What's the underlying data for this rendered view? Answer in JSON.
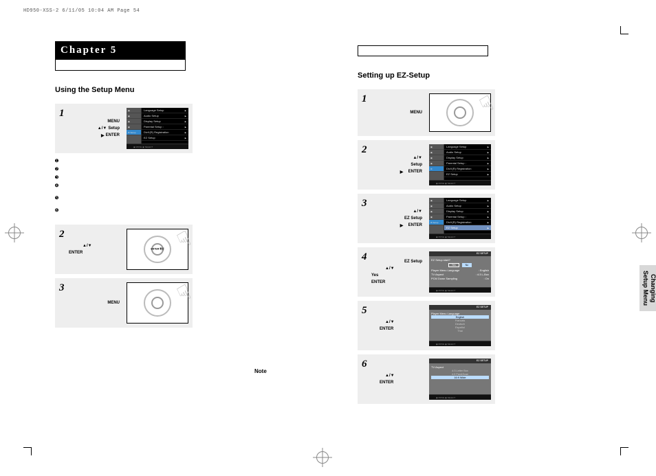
{
  "print_header": "HD950-XSS-2  6/11/05  10:04 AM  Page 54",
  "chapter": {
    "title": "Chapter 5"
  },
  "left": {
    "section_title": "Using the Setup Menu",
    "step1": {
      "hint1": "MENU",
      "hint2_arrows": "▲/▼",
      "hint2_label": "Setup",
      "hint3_arrow": "▶",
      "hint3_label": "ENTER",
      "menu_items": [
        "Language Setup",
        "Audio Setup",
        "Display Setup",
        "Parental Setup :",
        "DivX(R) Registration",
        "EZ Setup"
      ],
      "menu_foot": "◉ MOVE   ◉ SELECT"
    },
    "bullets": [
      "➊",
      "➋",
      "➌",
      "➍",
      "➎",
      "➏"
    ],
    "step2": {
      "arrows": "▲/▼",
      "enter": "ENTER",
      "center": "ENTER\n확인"
    },
    "step3": {
      "menu": "MENU"
    },
    "note_label": "Note"
  },
  "right": {
    "section_title": "Setting up EZ-Setup",
    "step1": {
      "menu": "MENU"
    },
    "step2": {
      "arrows": "▲/▼",
      "label": "Setup",
      "arrow2": "▶",
      "enter": "ENTER",
      "menu_items": [
        "Language Setup",
        "Audio Setup",
        "Display Setup",
        "Parental Setup :",
        "DivX(R) Registration",
        "EZ Setup"
      ]
    },
    "step3": {
      "arrows": "▲/▼",
      "label": "EZ Setup",
      "arrow2": "▶",
      "enter": "ENTER",
      "menu_items": [
        "Language Setup",
        "Audio Setup",
        "Display Setup",
        "Parental Setup :",
        "DivX(R) Registration",
        "EZ Setup"
      ]
    },
    "step4": {
      "label": "EZ Setup",
      "arrows": "▲/▼",
      "yes_label": "Yes",
      "enter": "ENTER",
      "title_bar": "EZ SETUP",
      "prompt": "EZ Setup start?",
      "yes": "Yes",
      "no": "No",
      "rows": [
        {
          "k": "Player Menu Language",
          "v": ": English"
        },
        {
          "k": "TV Aspect",
          "v": ": 4:3 L-Box"
        },
        {
          "k": "PCM Down Sampling",
          "v": ": On"
        }
      ]
    },
    "step5": {
      "arrows": "▲/▼",
      "enter": "ENTER",
      "title_bar": "EZ SETUP",
      "caption": "Player Menu Language",
      "options": [
        "English",
        "Francais",
        "Deutsch",
        "Español",
        "Thai"
      ],
      "active": 0
    },
    "step6": {
      "arrows": "▲/▼",
      "enter": "ENTER",
      "title_bar": "EZ SETUP",
      "caption": "TV Aspect",
      "options": [
        "4:3 Letter Box",
        "4:3 Pan&Scan",
        "16:9 Wide"
      ],
      "active": 2
    }
  },
  "side_tab": {
    "line1": "Changing",
    "line2": "Setup Menu"
  }
}
